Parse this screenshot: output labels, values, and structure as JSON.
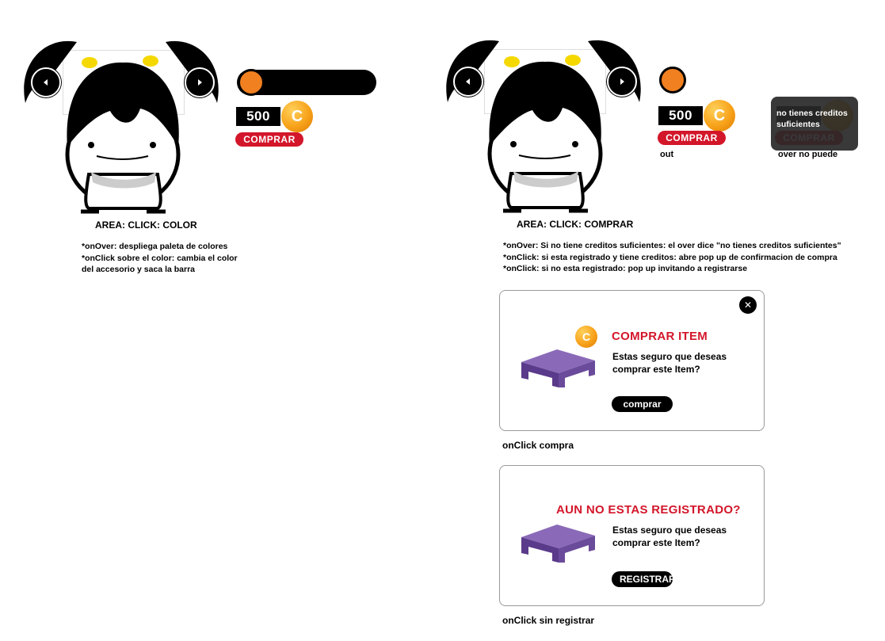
{
  "left_section": {
    "price": "500",
    "coin_symbol": "C",
    "buy_label": "COMPRAR",
    "area_label": "AREA: CLICK: COLOR",
    "notes": [
      "*onOver: despliega paleta de colores",
      "*onClick sobre el color: cambia el color",
      "del accesorio y saca la barra"
    ],
    "swatch_color": "#f08020"
  },
  "right_section": {
    "price": "500",
    "coin_symbol": "C",
    "buy_label": "COMPRAR",
    "state_out_label": "out",
    "state_over_label": "over no puede",
    "tooltip_text": "no tienes creditos suficientes",
    "area_label": "AREA: CLICK: COMPRAR",
    "notes": [
      "*onOver: Si no tiene creditos suficientes: el over dice \"no tienes creditos suficientes\"",
      "*onClick: si esta registrado y tiene creditos: abre pop up de confirmacion de compra",
      "*onClick: si no esta registrado: pop up invitando a registrarse"
    ]
  },
  "popup_buy": {
    "title": "COMPRAR ITEM",
    "text": "Estas seguro que deseas comprar este Item?",
    "button": "comprar",
    "coin_symbol": "C",
    "close_symbol": "✕",
    "caption": "onClick compra"
  },
  "popup_register": {
    "title": "AUN NO ESTAS REGISTRADO?",
    "text": "Estas seguro que deseas comprar este Item?",
    "button": "REGISTRAR",
    "caption": "onClick sin registrar"
  },
  "colors": {
    "accent_red": "#d3162a",
    "coin_orange": "#f7a21a",
    "item_purple": "#6a4a9a",
    "hair_bow_yellow": "#f5d800"
  }
}
